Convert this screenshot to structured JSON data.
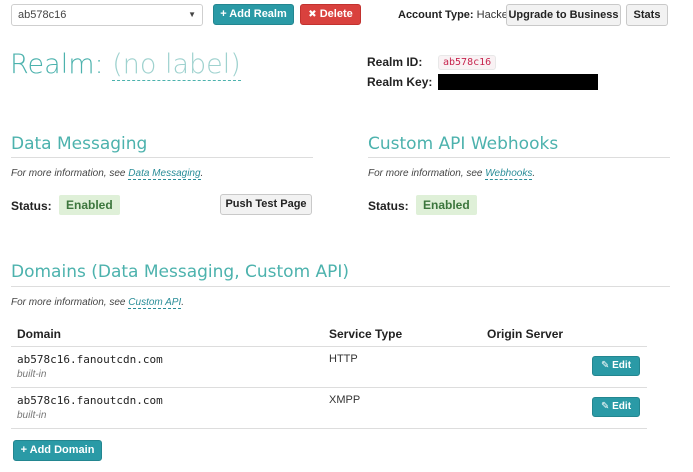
{
  "topbar": {
    "realm_select": "ab578c16",
    "add_realm": "+ Add Realm",
    "delete": "Delete",
    "delete_icon": "x-icon",
    "account_type_label": "Account Type:",
    "account_type_value": "Hacker",
    "upgrade": "Upgrade to Business",
    "stats": "Stats"
  },
  "realm": {
    "title": "Realm:",
    "label": "(no label)",
    "id_label": "Realm ID:",
    "id_value": "ab578c16",
    "key_label": "Realm Key:"
  },
  "data_messaging": {
    "title": "Data Messaging",
    "info_prefix": "For more information, see",
    "info_link": "Data Messaging",
    "info_suffix": ".",
    "status_label": "Status:",
    "status_value": "Enabled",
    "push_button": "Push Test Page"
  },
  "webhooks": {
    "title": "Custom API Webhooks",
    "info_prefix": "For more information, see",
    "info_link": "Webhooks",
    "info_suffix": ".",
    "status_label": "Status:",
    "status_value": "Enabled"
  },
  "domains": {
    "title": "Domains (Data Messaging, Custom API)",
    "info_prefix": "For more information, see",
    "info_link": "Custom API",
    "info_suffix": ".",
    "columns": [
      "Domain",
      "Service Type",
      "Origin Server"
    ],
    "rows": [
      {
        "domain": "ab578c16.fanoutcdn.com",
        "sub": "built-in",
        "service": "HTTP",
        "origin": "",
        "edit": "Edit"
      },
      {
        "domain": "ab578c16.fanoutcdn.com",
        "sub": "built-in",
        "service": "XMPP",
        "origin": "",
        "edit": "Edit"
      }
    ],
    "add_domain": "+ Add Domain"
  },
  "colors": {
    "accent": "#2a9aa6",
    "heading": "#4cb2ad",
    "danger": "#d9413e",
    "success_bg": "#dff0d8",
    "success_text": "#3c763d"
  }
}
